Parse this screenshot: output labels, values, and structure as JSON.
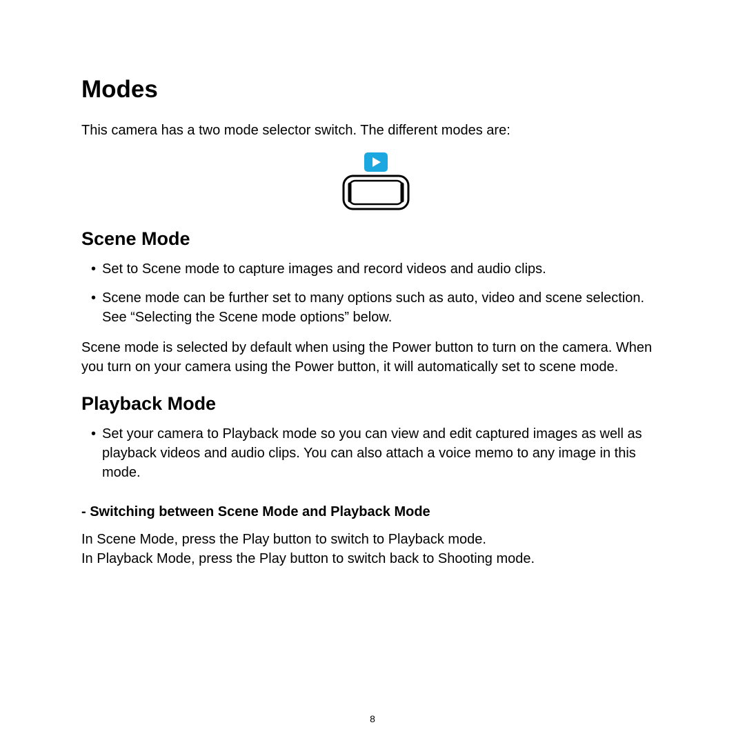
{
  "title": "Modes",
  "intro": "This camera has a two mode selector switch. The different modes are:",
  "scene": {
    "heading": "Scene Mode",
    "bullets": [
      "Set to Scene mode to capture images and record videos and audio clips.",
      "Scene mode can be further set to many options such as auto, video and scene selection. See “Selecting the Scene mode options” below."
    ],
    "body": "Scene mode is selected by default when using the Power button to turn on the camera. When you turn on your camera using the Power button, it will automatically set to scene mode."
  },
  "playback": {
    "heading": "Playback Mode",
    "bullets": [
      "Set your camera to Playback mode so you can view and edit captured images as well as playback videos and audio clips. You can also attach a voice memo to any image in this mode."
    ]
  },
  "switching": {
    "heading": "- Switching between Scene Mode and Playback Mode",
    "line1": "In Scene Mode, press the Play button to switch to Playback mode.",
    "line2": "In Playback Mode, press the Play button to switch back to Shooting mode."
  },
  "page_number": "8"
}
